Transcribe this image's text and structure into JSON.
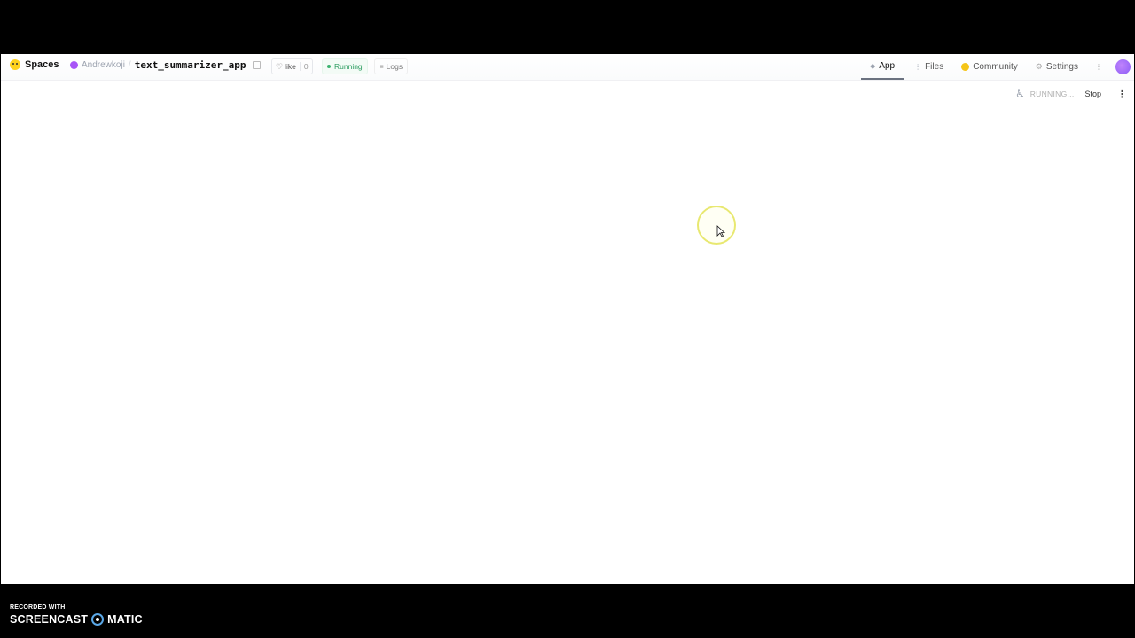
{
  "header": {
    "brand": "Spaces",
    "owner": "Andrewkoji",
    "separator": "/",
    "repo_name": "text_summarizer_app",
    "like_label": "like",
    "like_count": "0",
    "running_label": "Running",
    "logs_label": "Logs"
  },
  "nav": {
    "tabs": [
      {
        "label": "App",
        "icon": "app-icon",
        "active": true
      },
      {
        "label": "Files",
        "icon": "files-icon"
      },
      {
        "label": "Community",
        "icon": "community-icon"
      },
      {
        "label": "Settings",
        "icon": "gear-icon"
      }
    ]
  },
  "status": {
    "text": "RUNNING...",
    "stop_label": "Stop"
  },
  "watermark": {
    "top": "RECORDED WITH",
    "left": "SCREENCAST",
    "right": "MATIC"
  },
  "colors": {
    "accent": "#a855f7",
    "running": "#2f9e63"
  }
}
